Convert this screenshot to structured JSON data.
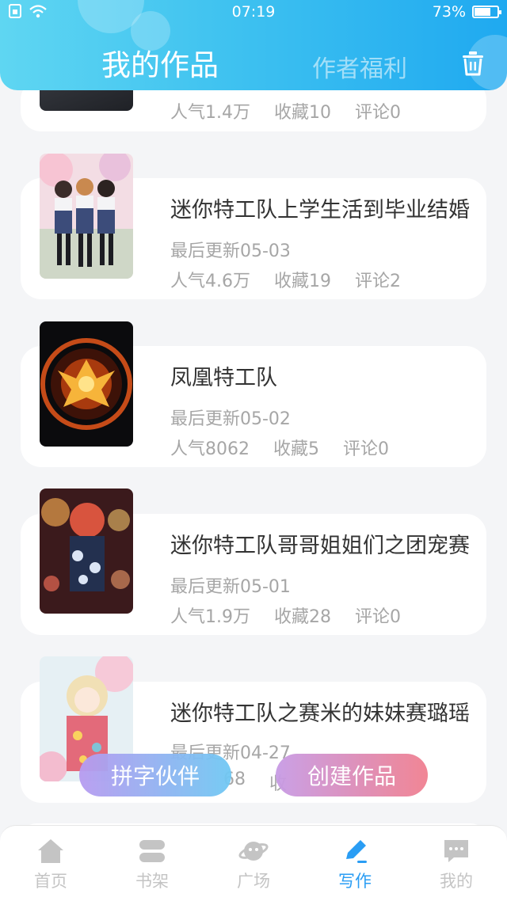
{
  "status": {
    "time": "07:19",
    "battery": "73%",
    "battery_level": 0.73
  },
  "header": {
    "title": "我的作品",
    "tab_benefits": "作者福利"
  },
  "works": [
    {
      "title": "",
      "updated": "",
      "popularity": "人气1.4万",
      "favorites": "收藏10",
      "comments": "评论0"
    },
    {
      "title": "迷你特工队上学生活到毕业结婚",
      "updated": "最后更新05-03",
      "popularity": "人气4.6万",
      "favorites": "收藏19",
      "comments": "评论2"
    },
    {
      "title": "凤凰特工队",
      "updated": "最后更新05-02",
      "popularity": "人气8062",
      "favorites": "收藏5",
      "comments": "评论0"
    },
    {
      "title": "迷你特工队哥哥姐姐们之团宠赛",
      "updated": "最后更新05-01",
      "popularity": "人气1.9万",
      "favorites": "收藏28",
      "comments": "评论0"
    },
    {
      "title": "迷你特工队之赛米的妹妹赛璐瑶",
      "updated": "最后更新04-27",
      "popularity": "68",
      "favorites": "收",
      "comments": ""
    }
  ],
  "buttons": {
    "partner": "拼字伙伴",
    "create": "创建作品"
  },
  "nav": [
    {
      "label": "首页",
      "icon": "home-icon"
    },
    {
      "label": "书架",
      "icon": "bookshelf-icon"
    },
    {
      "label": "广场",
      "icon": "planet-icon"
    },
    {
      "label": "写作",
      "icon": "pen-icon"
    },
    {
      "label": "我的",
      "icon": "chat-bubble-icon"
    }
  ],
  "colors": {
    "accent": "#2a9df4",
    "header_start": "#5fd6f2",
    "header_end": "#1fa9f0"
  }
}
